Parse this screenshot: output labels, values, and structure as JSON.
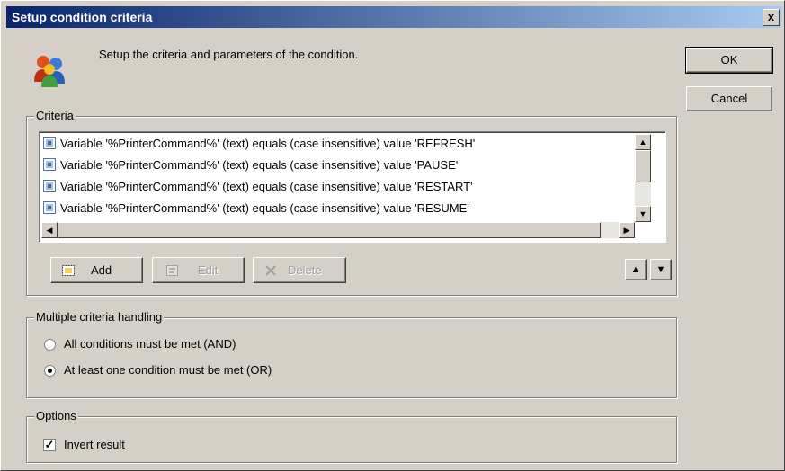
{
  "window": {
    "title": "Setup condition criteria",
    "close_glyph": "x"
  },
  "header": {
    "description": "Setup the criteria and parameters of the condition."
  },
  "buttons": {
    "ok": "OK",
    "cancel": "Cancel"
  },
  "criteria": {
    "label": "Criteria",
    "items": [
      "Variable '%PrinterCommand%' (text) equals (case insensitive) value 'REFRESH'",
      "Variable '%PrinterCommand%' (text) equals (case insensitive) value 'PAUSE'",
      "Variable '%PrinterCommand%' (text) equals (case insensitive) value 'RESTART'",
      "Variable '%PrinterCommand%' (text) equals (case insensitive) value 'RESUME'"
    ],
    "add_label": "Add",
    "edit_label": "Edit",
    "delete_label": "Delete"
  },
  "multiple": {
    "label": "Multiple criteria handling",
    "option_and": "All conditions must be met (AND)",
    "option_or": "At least one condition must be met (OR)",
    "selected": "OR"
  },
  "options": {
    "label": "Options",
    "invert_label": "Invert result",
    "invert_checked": true
  },
  "colors": {
    "title_start": "#0a246a",
    "title_end": "#a6caf0",
    "face": "#d4d0c8"
  },
  "icons": [
    "users-icon",
    "criteria-item-icon",
    "add-icon",
    "edit-icon",
    "delete-icon",
    "move-up-icon",
    "move-down-icon"
  ]
}
